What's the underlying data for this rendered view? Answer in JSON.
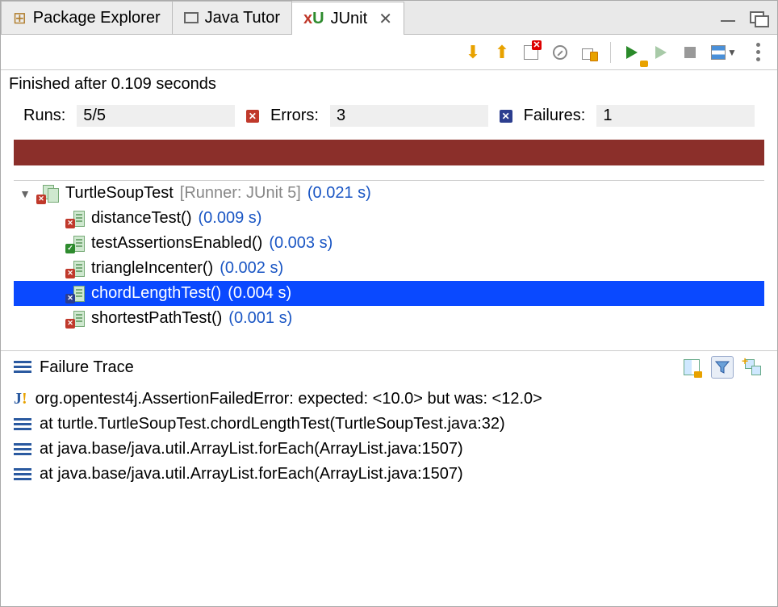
{
  "tabs": {
    "package_explorer": "Package Explorer",
    "java_tutor": "Java Tutor",
    "junit": "JUnit"
  },
  "status": {
    "finished": "Finished after 0.109 seconds"
  },
  "counts": {
    "runs_label": "Runs:",
    "runs_value": "5/5",
    "errors_label": "Errors:",
    "errors_value": "3",
    "failures_label": "Failures:",
    "failures_value": "1"
  },
  "tree": {
    "suite_name": "TurtleSoupTest",
    "suite_runner": "[Runner: JUnit 5]",
    "suite_time": "(0.021 s)",
    "tests": [
      {
        "name": "distanceTest()",
        "time": "(0.009 s)",
        "status": "err",
        "selected": false
      },
      {
        "name": "testAssertionsEnabled()",
        "time": "(0.003 s)",
        "status": "pass",
        "selected": false
      },
      {
        "name": "triangleIncenter()",
        "time": "(0.002 s)",
        "status": "err",
        "selected": false
      },
      {
        "name": "chordLengthTest()",
        "time": "(0.004 s)",
        "status": "fail",
        "selected": true
      },
      {
        "name": "shortestPathTest()",
        "time": "(0.001 s)",
        "status": "err",
        "selected": false
      }
    ]
  },
  "trace": {
    "title": "Failure Trace",
    "lines": [
      "org.opentest4j.AssertionFailedError: expected: <10.0> but was: <12.0>",
      "at turtle.TurtleSoupTest.chordLengthTest(TurtleSoupTest.java:32)",
      "at java.base/java.util.ArrayList.forEach(ArrayList.java:1507)",
      "at java.base/java.util.ArrayList.forEach(ArrayList.java:1507)"
    ]
  }
}
